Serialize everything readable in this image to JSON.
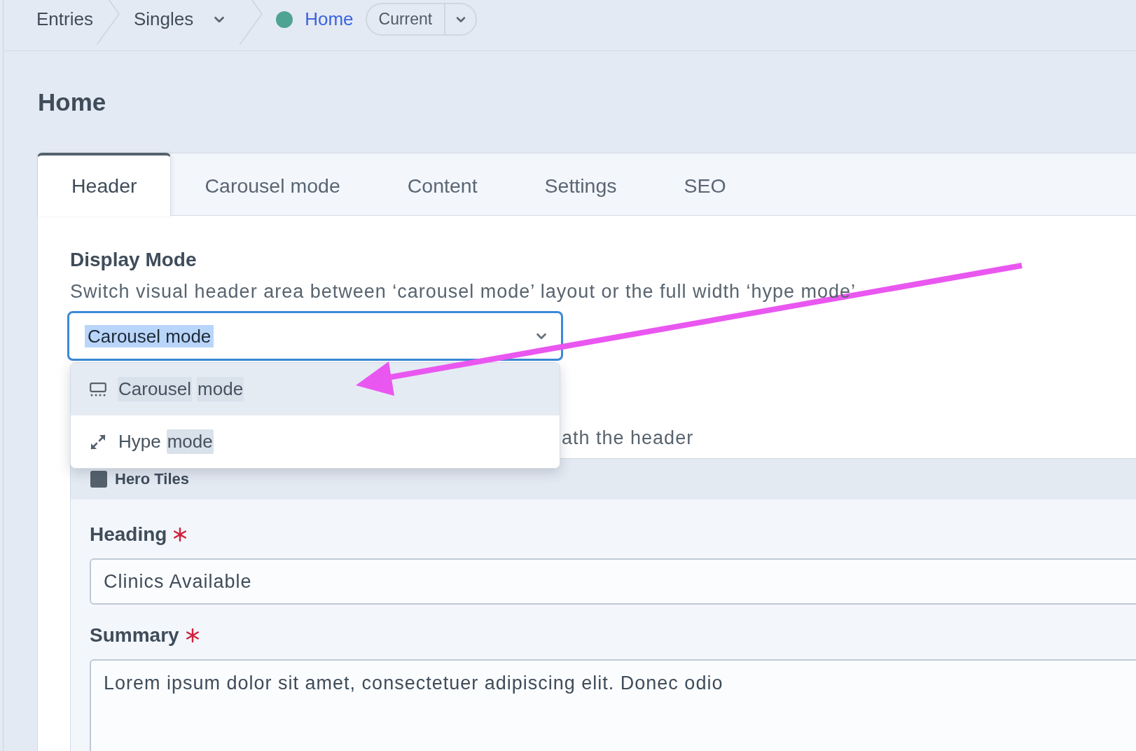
{
  "breadcrumbs": {
    "items": [
      {
        "label": "Entries",
        "has_menu": false
      },
      {
        "label": "Singles",
        "has_menu": true
      }
    ],
    "current": {
      "label": "Home",
      "color": "#4fa393"
    },
    "revision": {
      "label": "Current"
    }
  },
  "page_title": "Home",
  "tabs": [
    {
      "label": "Header",
      "selected": true
    },
    {
      "label": "Carousel mode",
      "selected": false
    },
    {
      "label": "Content",
      "selected": false
    },
    {
      "label": "Settings",
      "selected": false
    },
    {
      "label": "SEO",
      "selected": false
    }
  ],
  "display_mode": {
    "label": "Display Mode",
    "instructions": "Switch visual header area between ‘carousel mode’ layout or the full width ‘hype mode’",
    "value": "Carousel mode",
    "focused": true,
    "text_selected": true,
    "expanded": true,
    "options": [
      {
        "kind": "carousel",
        "selected": true,
        "parts": [
          {
            "text": "Carousel",
            "match": true
          },
          {
            "text": "mode",
            "match": true
          }
        ]
      },
      {
        "kind": "hype",
        "selected": false,
        "parts": [
          {
            "text": "Hype",
            "match": false
          },
          {
            "text": "mode",
            "match": true
          }
        ]
      }
    ]
  },
  "covered_instructions": "ath the header",
  "matrix_block": {
    "type_label": "Hero Tiles",
    "fields": [
      {
        "kind": "text",
        "label": "Heading",
        "required": true,
        "value": "Clinics Available"
      },
      {
        "kind": "textarea",
        "label": "Summary",
        "required": true,
        "value": "Lorem ipsum dolor sit amet, consectetuer adipiscing elit. Donec odio"
      }
    ]
  }
}
